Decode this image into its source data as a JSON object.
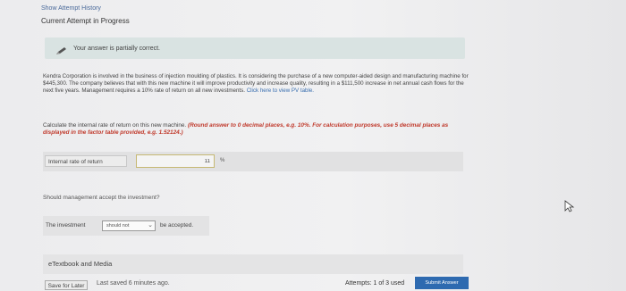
{
  "header": {
    "show_history": "Show Attempt History",
    "current_attempt": "Current Attempt in Progress"
  },
  "alert": {
    "icon": "pencil-icon",
    "text": "Your answer is partially correct."
  },
  "problem": {
    "text": "Kendra Corporation is involved in the business of injection moulding of plastics. It is considering the purchase of a new computer-aided design and manufacturing machine for $445,300. The company believes that with this new machine it will improve productivity and increase quality, resulting in a $111,500 increase in net annual cash flows for the next five years. Management requires a 10% rate of return on all new investments.",
    "link": "Click here to view PV table."
  },
  "instruction": {
    "text": "Calculate the internal rate of return on this new machine.",
    "note": "(Round answer to 0 decimal places, e.g. 10%. For calculation purposes, use 5 decimal places as displayed in the factor table provided, e.g. 1.52124.)"
  },
  "irr": {
    "label": "Internal rate of return",
    "value": "11",
    "unit": "%"
  },
  "decision": {
    "question": "Should management accept the investment?",
    "lead": "The investment",
    "selected": "should not",
    "tail": "be accepted."
  },
  "etextbook": {
    "label": "eTextbook and Media"
  },
  "footer": {
    "save": "Save for Later",
    "last_saved": "Last saved 6 minutes ago.",
    "attempts": "Attempts: 1 of 3 used",
    "submit": "Submit Answer"
  }
}
